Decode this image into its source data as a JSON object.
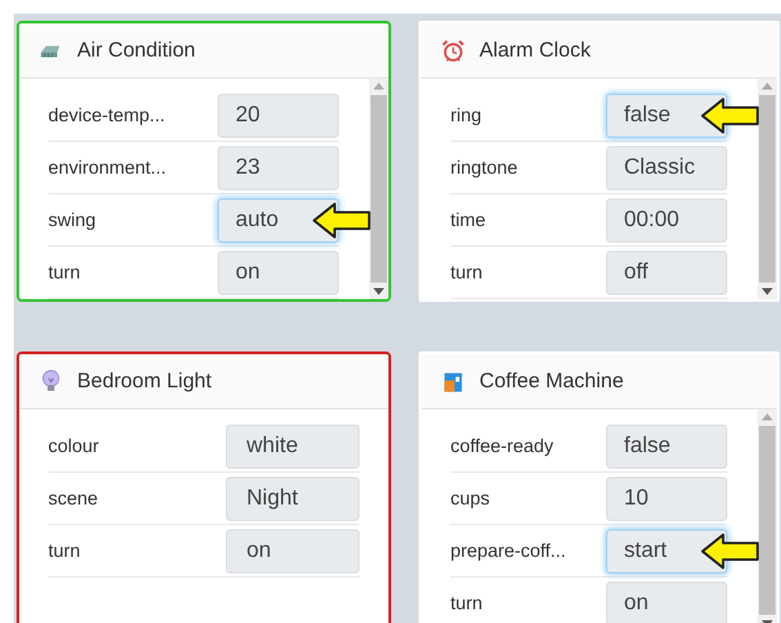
{
  "cards": [
    {
      "kind": "air-conditioner",
      "title": "Air Condition",
      "color": "#33c433",
      "scrollable": true,
      "fields": [
        {
          "label": "device-temp...",
          "value": "20",
          "highlighted": false
        },
        {
          "label": "environment...",
          "value": "23",
          "highlighted": false
        },
        {
          "label": "swing",
          "value": "auto",
          "highlighted": true
        },
        {
          "label": "turn",
          "value": "on",
          "highlighted": false
        }
      ]
    },
    {
      "kind": "alarm-clock",
      "title": "Alarm Clock",
      "scrollable": true,
      "fields": [
        {
          "label": "ring",
          "value": "false",
          "highlighted": true
        },
        {
          "label": "ringtone",
          "value": "Classic",
          "highlighted": false
        },
        {
          "label": "time",
          "value": "00:00",
          "highlighted": false
        },
        {
          "label": "turn",
          "value": "off",
          "highlighted": false
        }
      ]
    },
    {
      "kind": "light-bulb",
      "title": "Bedroom Light",
      "color": "#d42020",
      "scrollable": false,
      "fields": [
        {
          "label": "colour",
          "value": "white",
          "highlighted": false
        },
        {
          "label": "scene",
          "value": "Night",
          "highlighted": false
        },
        {
          "label": "turn",
          "value": "on",
          "highlighted": false
        }
      ]
    },
    {
      "kind": "coffee-machine",
      "title": "Coffee Machine",
      "scrollable": true,
      "fields": [
        {
          "label": "coffee-ready",
          "value": "false",
          "highlighted": false
        },
        {
          "label": "cups",
          "value": "10",
          "highlighted": false
        },
        {
          "label": "prepare-coff...",
          "value": "start",
          "highlighted": true
        },
        {
          "label": "turn",
          "value": "on",
          "highlighted": false
        }
      ]
    }
  ]
}
